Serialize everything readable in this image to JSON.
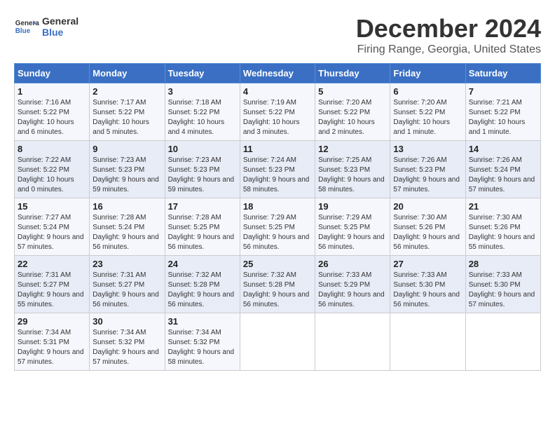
{
  "logo": {
    "line1": "General",
    "line2": "Blue"
  },
  "title": "December 2024",
  "subtitle": "Firing Range, Georgia, United States",
  "days_of_week": [
    "Sunday",
    "Monday",
    "Tuesday",
    "Wednesday",
    "Thursday",
    "Friday",
    "Saturday"
  ],
  "weeks": [
    [
      {
        "day": "1",
        "sunrise": "Sunrise: 7:16 AM",
        "sunset": "Sunset: 5:22 PM",
        "daylight": "Daylight: 10 hours and 6 minutes."
      },
      {
        "day": "2",
        "sunrise": "Sunrise: 7:17 AM",
        "sunset": "Sunset: 5:22 PM",
        "daylight": "Daylight: 10 hours and 5 minutes."
      },
      {
        "day": "3",
        "sunrise": "Sunrise: 7:18 AM",
        "sunset": "Sunset: 5:22 PM",
        "daylight": "Daylight: 10 hours and 4 minutes."
      },
      {
        "day": "4",
        "sunrise": "Sunrise: 7:19 AM",
        "sunset": "Sunset: 5:22 PM",
        "daylight": "Daylight: 10 hours and 3 minutes."
      },
      {
        "day": "5",
        "sunrise": "Sunrise: 7:20 AM",
        "sunset": "Sunset: 5:22 PM",
        "daylight": "Daylight: 10 hours and 2 minutes."
      },
      {
        "day": "6",
        "sunrise": "Sunrise: 7:20 AM",
        "sunset": "Sunset: 5:22 PM",
        "daylight": "Daylight: 10 hours and 1 minute."
      },
      {
        "day": "7",
        "sunrise": "Sunrise: 7:21 AM",
        "sunset": "Sunset: 5:22 PM",
        "daylight": "Daylight: 10 hours and 1 minute."
      }
    ],
    [
      {
        "day": "8",
        "sunrise": "Sunrise: 7:22 AM",
        "sunset": "Sunset: 5:22 PM",
        "daylight": "Daylight: 10 hours and 0 minutes."
      },
      {
        "day": "9",
        "sunrise": "Sunrise: 7:23 AM",
        "sunset": "Sunset: 5:23 PM",
        "daylight": "Daylight: 9 hours and 59 minutes."
      },
      {
        "day": "10",
        "sunrise": "Sunrise: 7:23 AM",
        "sunset": "Sunset: 5:23 PM",
        "daylight": "Daylight: 9 hours and 59 minutes."
      },
      {
        "day": "11",
        "sunrise": "Sunrise: 7:24 AM",
        "sunset": "Sunset: 5:23 PM",
        "daylight": "Daylight: 9 hours and 58 minutes."
      },
      {
        "day": "12",
        "sunrise": "Sunrise: 7:25 AM",
        "sunset": "Sunset: 5:23 PM",
        "daylight": "Daylight: 9 hours and 58 minutes."
      },
      {
        "day": "13",
        "sunrise": "Sunrise: 7:26 AM",
        "sunset": "Sunset: 5:23 PM",
        "daylight": "Daylight: 9 hours and 57 minutes."
      },
      {
        "day": "14",
        "sunrise": "Sunrise: 7:26 AM",
        "sunset": "Sunset: 5:24 PM",
        "daylight": "Daylight: 9 hours and 57 minutes."
      }
    ],
    [
      {
        "day": "15",
        "sunrise": "Sunrise: 7:27 AM",
        "sunset": "Sunset: 5:24 PM",
        "daylight": "Daylight: 9 hours and 57 minutes."
      },
      {
        "day": "16",
        "sunrise": "Sunrise: 7:28 AM",
        "sunset": "Sunset: 5:24 PM",
        "daylight": "Daylight: 9 hours and 56 minutes."
      },
      {
        "day": "17",
        "sunrise": "Sunrise: 7:28 AM",
        "sunset": "Sunset: 5:25 PM",
        "daylight": "Daylight: 9 hours and 56 minutes."
      },
      {
        "day": "18",
        "sunrise": "Sunrise: 7:29 AM",
        "sunset": "Sunset: 5:25 PM",
        "daylight": "Daylight: 9 hours and 56 minutes."
      },
      {
        "day": "19",
        "sunrise": "Sunrise: 7:29 AM",
        "sunset": "Sunset: 5:25 PM",
        "daylight": "Daylight: 9 hours and 56 minutes."
      },
      {
        "day": "20",
        "sunrise": "Sunrise: 7:30 AM",
        "sunset": "Sunset: 5:26 PM",
        "daylight": "Daylight: 9 hours and 56 minutes."
      },
      {
        "day": "21",
        "sunrise": "Sunrise: 7:30 AM",
        "sunset": "Sunset: 5:26 PM",
        "daylight": "Daylight: 9 hours and 55 minutes."
      }
    ],
    [
      {
        "day": "22",
        "sunrise": "Sunrise: 7:31 AM",
        "sunset": "Sunset: 5:27 PM",
        "daylight": "Daylight: 9 hours and 55 minutes."
      },
      {
        "day": "23",
        "sunrise": "Sunrise: 7:31 AM",
        "sunset": "Sunset: 5:27 PM",
        "daylight": "Daylight: 9 hours and 56 minutes."
      },
      {
        "day": "24",
        "sunrise": "Sunrise: 7:32 AM",
        "sunset": "Sunset: 5:28 PM",
        "daylight": "Daylight: 9 hours and 56 minutes."
      },
      {
        "day": "25",
        "sunrise": "Sunrise: 7:32 AM",
        "sunset": "Sunset: 5:28 PM",
        "daylight": "Daylight: 9 hours and 56 minutes."
      },
      {
        "day": "26",
        "sunrise": "Sunrise: 7:33 AM",
        "sunset": "Sunset: 5:29 PM",
        "daylight": "Daylight: 9 hours and 56 minutes."
      },
      {
        "day": "27",
        "sunrise": "Sunrise: 7:33 AM",
        "sunset": "Sunset: 5:30 PM",
        "daylight": "Daylight: 9 hours and 56 minutes."
      },
      {
        "day": "28",
        "sunrise": "Sunrise: 7:33 AM",
        "sunset": "Sunset: 5:30 PM",
        "daylight": "Daylight: 9 hours and 57 minutes."
      }
    ],
    [
      {
        "day": "29",
        "sunrise": "Sunrise: 7:34 AM",
        "sunset": "Sunset: 5:31 PM",
        "daylight": "Daylight: 9 hours and 57 minutes."
      },
      {
        "day": "30",
        "sunrise": "Sunrise: 7:34 AM",
        "sunset": "Sunset: 5:32 PM",
        "daylight": "Daylight: 9 hours and 57 minutes."
      },
      {
        "day": "31",
        "sunrise": "Sunrise: 7:34 AM",
        "sunset": "Sunset: 5:32 PM",
        "daylight": "Daylight: 9 hours and 58 minutes."
      },
      null,
      null,
      null,
      null
    ]
  ],
  "colors": {
    "header_bg": "#3a6fc4",
    "odd_row": "#f5f7fc",
    "even_row": "#e8ecf7"
  }
}
